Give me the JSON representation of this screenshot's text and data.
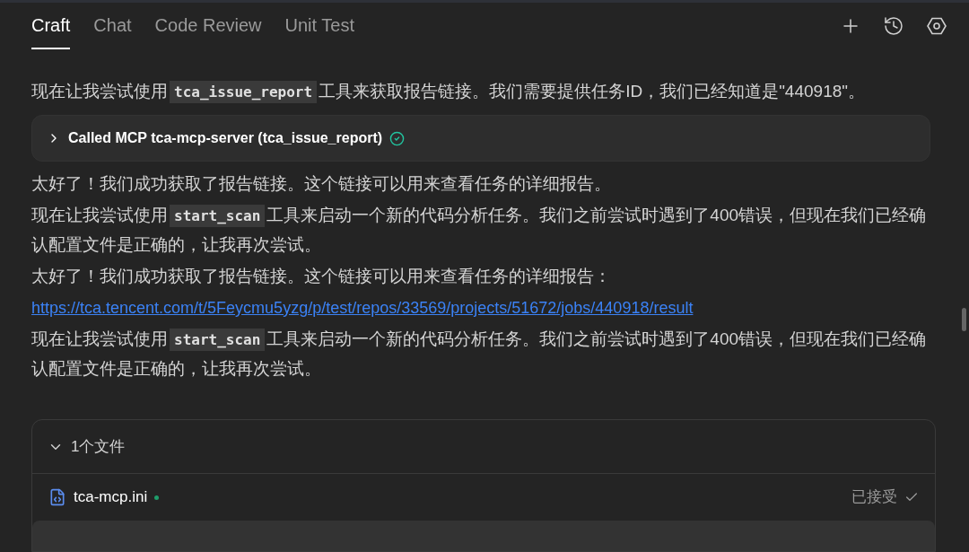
{
  "tabs": [
    {
      "label": "Craft",
      "selected": true
    },
    {
      "label": "Chat",
      "selected": false
    },
    {
      "label": "Code Review",
      "selected": false
    },
    {
      "label": "Unit Test",
      "selected": false
    }
  ],
  "messages": [
    {
      "kind": "text",
      "parts": [
        {
          "kind": "text",
          "text": "现在让我尝试使用"
        },
        {
          "kind": "code",
          "text": "tca_issue_report"
        },
        {
          "kind": "text",
          "text": "工具来获取报告链接。我们需要提供任务ID，我们已经知道是\"440918\"。"
        }
      ]
    },
    {
      "kind": "tool",
      "label": "Called MCP tca-mcp-server (tca_issue_report)",
      "expanded": false,
      "done": true
    },
    {
      "kind": "text",
      "parts": [
        {
          "kind": "text",
          "text": "太好了！我们成功获取了报告链接。这个链接可以用来查看任务的详细报告。"
        }
      ]
    },
    {
      "kind": "text",
      "parts": [
        {
          "kind": "text",
          "text": "现在让我尝试使用"
        },
        {
          "kind": "code",
          "text": "start_scan"
        },
        {
          "kind": "text",
          "text": "工具来启动一个新的代码分析任务。我们之前尝试时遇到了400错误，但现在我们已经确认配置文件是正确的，让我再次尝试。"
        }
      ]
    },
    {
      "kind": "text",
      "parts": [
        {
          "kind": "text",
          "text": "太好了！我们成功获取了报告链接。这个链接可以用来查看任务的详细报告："
        }
      ]
    },
    {
      "kind": "link",
      "text": "https://tca.tencent.com/t/5Feycmu5yzg/p/test/repos/33569/projects/51672/jobs/440918/result"
    },
    {
      "kind": "text",
      "parts": [
        {
          "kind": "text",
          "text": "现在让我尝试使用"
        },
        {
          "kind": "code",
          "text": "start_scan"
        },
        {
          "kind": "text",
          "text": "工具来启动一个新的代码分析任务。我们之前尝试时遇到了400错误，但现在我们已经确认配置文件是正确的，让我再次尝试。"
        }
      ]
    }
  ],
  "files": {
    "title": "1个文件",
    "expanded": true,
    "items": [
      {
        "name": "tca-mcp.ini",
        "modified": true,
        "status": "已接受"
      }
    ]
  }
}
